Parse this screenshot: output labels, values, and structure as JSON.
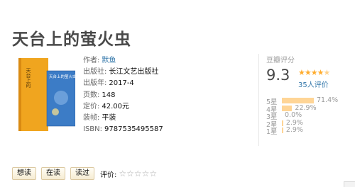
{
  "book": {
    "title": "天台上的萤火虫",
    "cover": {
      "text_left": "天台上的",
      "text_right": "天台上的萤火虫",
      "colors": {
        "left": "#f2a21c",
        "right": "#3b78c2"
      }
    },
    "info": [
      {
        "label": "作者:",
        "value": "默鱼",
        "link": true
      },
      {
        "label": "出版社:",
        "value": "长江文艺出版社",
        "link": false
      },
      {
        "label": "出版年:",
        "value": "2017-4",
        "link": false
      },
      {
        "label": "页数:",
        "value": "148",
        "link": false
      },
      {
        "label": "定价:",
        "value": "42.00元",
        "link": false
      },
      {
        "label": "装帧:",
        "value": "平装",
        "link": false
      },
      {
        "label": "ISBN:",
        "value": "9787535495587",
        "link": false
      }
    ]
  },
  "rating": {
    "heading": "豆瓣评分",
    "score": "9.3",
    "stars": 4.5,
    "count_text": "35人评价",
    "distribution": [
      {
        "label": "5星",
        "percent": 71.4,
        "percent_text": "71.4%"
      },
      {
        "label": "4星",
        "percent": 22.9,
        "percent_text": "22.9%"
      },
      {
        "label": "3星",
        "percent": 0.0,
        "percent_text": "0.0%"
      },
      {
        "label": "2星",
        "percent": 2.9,
        "percent_text": "2.9%"
      },
      {
        "label": "1星",
        "percent": 2.9,
        "percent_text": "2.9%"
      }
    ]
  },
  "actions": {
    "want": "想读",
    "reading": "在读",
    "read": "读过",
    "rate_label": "评价:",
    "rate_stars": "☆☆☆☆☆"
  }
}
